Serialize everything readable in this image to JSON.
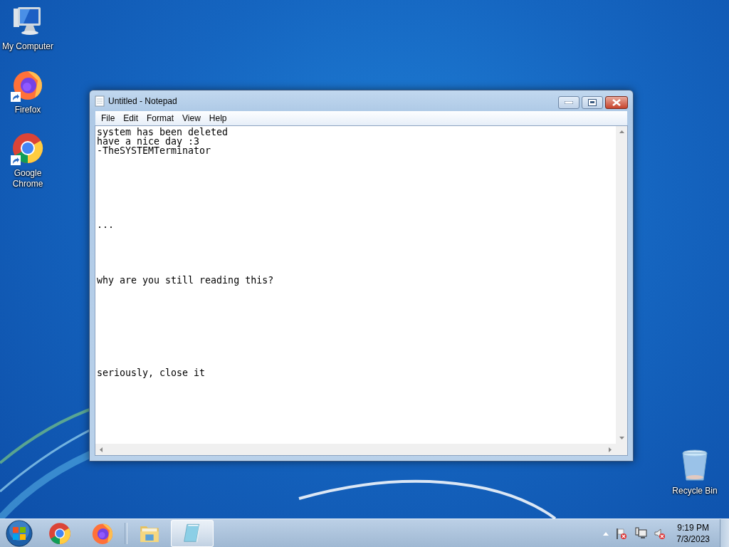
{
  "desktop": {
    "icons": [
      {
        "label": "My Computer",
        "kind": "computer",
        "shortcut": false
      },
      {
        "label": "Firefox",
        "kind": "firefox",
        "shortcut": true
      },
      {
        "label": "Google Chrome",
        "kind": "chrome",
        "shortcut": true
      }
    ],
    "recycle_bin": {
      "label": "Recycle Bin"
    }
  },
  "window": {
    "title": "Untitled - Notepad",
    "menu": [
      "File",
      "Edit",
      "Format",
      "View",
      "Help"
    ],
    "content": "system has been deleted\nhave a nice day :3\n-TheSYSTEMTerminator\n\n\n\n\n\n\n\n...\n\n\n\n\n\nwhy are you still reading this?\n\n\n\n\n\n\n\n\n\nseriously, close it"
  },
  "taskbar": {
    "pinned": [
      {
        "kind": "chrome",
        "selected": false
      },
      {
        "kind": "firefox",
        "selected": false
      },
      {
        "kind": "explorer",
        "selected": false
      },
      {
        "kind": "notepad",
        "selected": true
      }
    ],
    "tray": [
      {
        "kind": "arrow"
      },
      {
        "kind": "flag"
      },
      {
        "kind": "network"
      },
      {
        "kind": "speaker"
      }
    ],
    "clock": {
      "time": "9:19 PM",
      "date": "7/3/2023"
    }
  }
}
